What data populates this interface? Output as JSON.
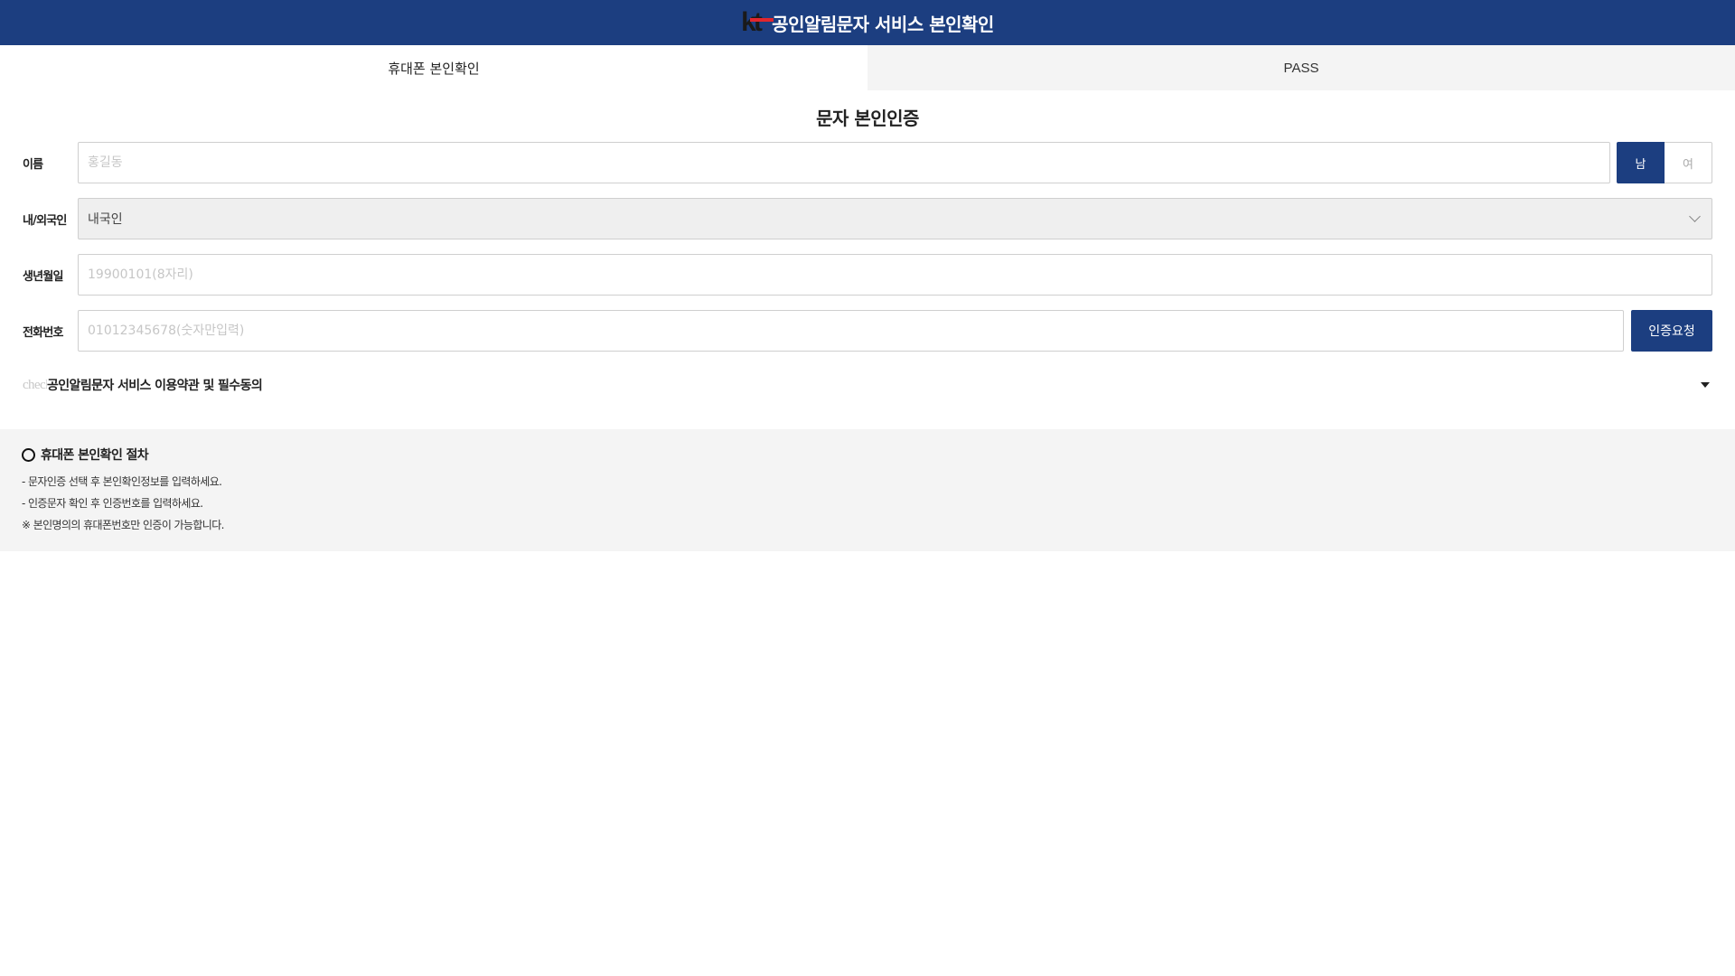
{
  "header": {
    "logo_text": "kt",
    "title": "공인알림문자 서비스 본인확인"
  },
  "tabs": [
    {
      "label": "휴대폰 본인확인",
      "active": true
    },
    {
      "label": "PASS",
      "active": false
    }
  ],
  "section_title": "문자 본인인증",
  "form": {
    "name": {
      "label": "이름",
      "value": "",
      "placeholder": "홍길동"
    },
    "gender": {
      "male_label": "남",
      "female_label": "여",
      "selected": "남"
    },
    "nationality": {
      "label": "내/외국인",
      "selected": "내국인"
    },
    "birth": {
      "label": "생년월일",
      "value": "",
      "placeholder": "19900101(8자리)"
    },
    "phone": {
      "label": "전화번호",
      "value": "",
      "placeholder": "01012345678(숫자만입력)",
      "request_label": "인증요청"
    }
  },
  "terms": {
    "checkbox_alt": "checkbox",
    "label": "공인알림문자 서비스 이용약관 및 필수동의"
  },
  "info": {
    "title": "휴대폰 본인확인 절차",
    "lines": [
      "-  문자인증 선택 후 본인확인정보를 입력하세요.",
      "-  인증문자 확인 후 인증번호를 입력하세요.",
      "※ 본인명의의 휴대폰번호만 인증이 가능합니다."
    ]
  },
  "colors": {
    "primary": "#1c3e80",
    "logo_red": "#e2262d",
    "panel_bg": "#f4f4f4"
  }
}
